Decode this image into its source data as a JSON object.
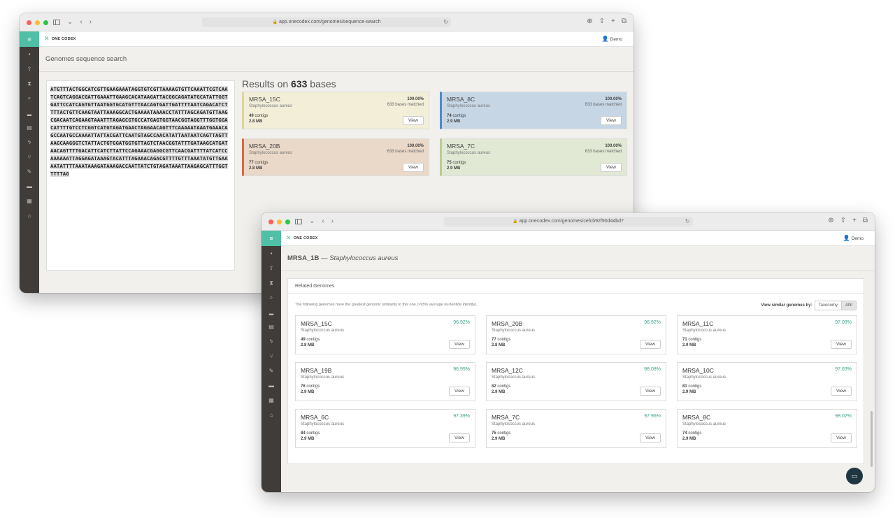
{
  "window1": {
    "url": "app.onecodex.com/genomes/sequence-search",
    "brand": "ONE CODEX",
    "user": "Demo",
    "page_title": "Genomes sequence search",
    "sequence": "ATGTTTACTGGCATCGTTGAAGAAATAGGTGTCGTTAAAAGTGTTCAAATTCGTCAATCAGTCAGGACGATTGAAATTGAAGCACATAAGATTACGGCAGATATGCATATTGGTGATTCCATCAGTGTTAATGGTGCATGTTTAACAGTGATTGATTTTAATCAGACATCTTTTACTGTTCAAGTAATTAAAGGCACTGAAAATAAAACCTATTTAGCAGATGTTAAGCGACAATCAGAAGTAAATTTAGAGCGTGCCATGAGTGGTAACGGTAGGTTTGGTGGACATTTTGTCCTCGGTCATGTAGATGAACTAGGAACAGTTTCAAAAATAAATGAAACAGCCAATGCCAAAATTATTACGATTCAATGTAGCCAACATATTAATAATCAGTTAGTTAAGCAAGGGTCTATTACTGTGGATGGTGTTAGTCTAACGGTATTTGATAAGCATGATAACAGTTTTGACATTCATCTTATTCCAGAAACGAGGCGTTCAACGATTTTATCATCCAAAAAATTAGGAGATAAAGTACATTTAGAAACAGACGTTTTGTTTAAATATGTTGAAAATATTTTAAATAAAGATAAAGACCAATTATCTGTAGATAAATTAAGAGCATTTGGTTTTTAG",
    "results_prefix": "Results on ",
    "results_count": "633",
    "results_suffix": " bases",
    "results": [
      {
        "name": "MRSA_15C",
        "species": "Staphylococcus aureus",
        "pct": "100.00%",
        "matched": "633 bases matched",
        "contigs": "49",
        "contigs_label": " contigs",
        "size": "2.8 MB",
        "button": "View"
      },
      {
        "name": "MRSA_8C",
        "species": "Staphylococcus aureus",
        "pct": "100.00%",
        "matched": "633 bases matched",
        "contigs": "74",
        "contigs_label": " contigs",
        "size": "2.9 MB",
        "button": "View"
      },
      {
        "name": "MRSA_20B",
        "species": "Staphylococcus aureus",
        "pct": "100.00%",
        "matched": "633 bases matched",
        "contigs": "77",
        "contigs_label": " contigs",
        "size": "2.8 MB",
        "button": "View"
      },
      {
        "name": "MRSA_7C",
        "species": "Staphylococcus aureus",
        "pct": "100.00%",
        "matched": "633 bases matched",
        "contigs": "75",
        "contigs_label": " contigs",
        "size": "2.9 MB",
        "button": "View"
      }
    ]
  },
  "window2": {
    "url": "app.onecodex.com/genomes/cefcb92f90d44bd7",
    "brand": "ONE CODEX",
    "user": "Demo",
    "genome_name": "MRSA_1B",
    "genome_separator": " — ",
    "genome_species": "Staphylococcus aureus",
    "panel_title": "Related Genomes",
    "note": "The following genomes have the greatest genomic similarity to this one (>95% average nucleotide identity).",
    "view_by_label": "View similar genomes by:",
    "view_by_options": [
      "Taxonomy",
      "ANI"
    ],
    "genomes": [
      {
        "name": "MRSA_15C",
        "species": "Staphylococcus aureus",
        "ani": "96.92%",
        "contigs": "49",
        "contigs_label": " contigs",
        "size": "2.8 MB",
        "button": "View"
      },
      {
        "name": "MRSA_20B",
        "species": "Staphylococcus aureus",
        "ani": "96.92%",
        "contigs": "77",
        "contigs_label": " contigs",
        "size": "2.8 MB",
        "button": "View"
      },
      {
        "name": "MRSA_11C",
        "species": "Staphylococcus aureus",
        "ani": "97.09%",
        "contigs": "71",
        "contigs_label": " contigs",
        "size": "2.9 MB",
        "button": "View"
      },
      {
        "name": "MRSA_19B",
        "species": "Staphylococcus aureus",
        "ani": "96.95%",
        "contigs": "76",
        "contigs_label": " contigs",
        "size": "2.9 MB",
        "button": "View"
      },
      {
        "name": "MRSA_12C",
        "species": "Staphylococcus aureus",
        "ani": "98.08%",
        "contigs": "82",
        "contigs_label": " contigs",
        "size": "2.9 MB",
        "button": "View"
      },
      {
        "name": "MRSA_10C",
        "species": "Staphylococcus aureus",
        "ani": "97.63%",
        "contigs": "81",
        "contigs_label": " contigs",
        "size": "2.9 MB",
        "button": "View"
      },
      {
        "name": "MRSA_6C",
        "species": "Staphylococcus aureus",
        "ani": "97.39%",
        "contigs": "84",
        "contigs_label": " contigs",
        "size": "2.9 MB",
        "button": "View"
      },
      {
        "name": "MRSA_7C",
        "species": "Staphylococcus aureus",
        "ani": "97.96%",
        "contigs": "75",
        "contigs_label": " contigs",
        "size": "2.9 MB",
        "button": "View"
      },
      {
        "name": "MRSA_8C",
        "species": "Staphylococcus aureus",
        "ani": "98.02%",
        "contigs": "74",
        "contigs_label": " contigs",
        "size": "2.9 MB",
        "button": "View"
      }
    ]
  },
  "icons": {
    "menu": "≡",
    "rail": [
      "▪",
      "⇧",
      "⧗",
      "⌕",
      "▂",
      "▤",
      "ϟ",
      "⑂",
      "✎",
      "▬",
      "▦",
      "⌂"
    ],
    "user": "👤"
  },
  "colors": {
    "accent": "#4fbfa6",
    "rail": "#3f3c3a",
    "ani_text": "#3aa28a"
  }
}
